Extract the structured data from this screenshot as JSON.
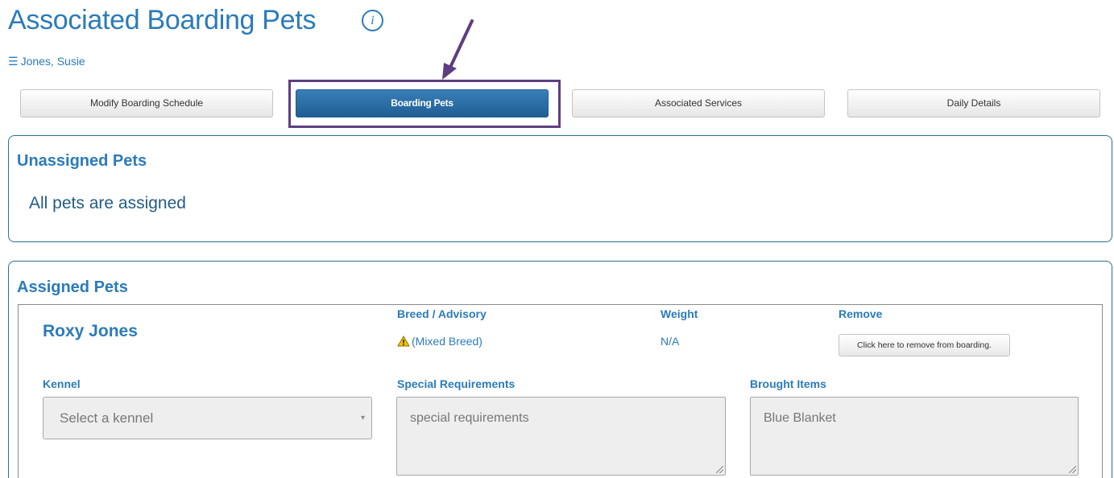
{
  "header": {
    "title": "Associated Boarding Pets",
    "info_icon": "info-icon"
  },
  "breadcrumb": {
    "menu_icon": "☰",
    "client_name": "Jones, Susie"
  },
  "tabs": [
    {
      "label": "Modify Boarding Schedule",
      "active": false
    },
    {
      "label": "Boarding Pets",
      "active": true
    },
    {
      "label": "Associated Services",
      "active": false
    },
    {
      "label": "Daily Details",
      "active": false
    }
  ],
  "annotation": {
    "highlight_color": "#5d3f80"
  },
  "unassigned": {
    "title": "Unassigned Pets",
    "message": "All pets are assigned"
  },
  "assigned": {
    "title": "Assigned Pets",
    "pet": {
      "name": "Roxy Jones",
      "breed_label": "Breed / Advisory",
      "breed_value": "(Mixed Breed)",
      "advisory_icon": "warning-icon",
      "weight_label": "Weight",
      "weight_value": "N/A",
      "remove_label": "Remove",
      "remove_button": "Click here to remove from boarding.",
      "kennel_label": "Kennel",
      "kennel_placeholder": "Select a kennel",
      "special_label": "Special Requirements",
      "special_placeholder": "special requirements",
      "brought_label": "Brought Items",
      "brought_value": "Blue Blanket"
    }
  },
  "colors": {
    "accent": "#2b7bb9",
    "active_tab": "#1f5d93",
    "panel_border": "#2a6f97"
  }
}
